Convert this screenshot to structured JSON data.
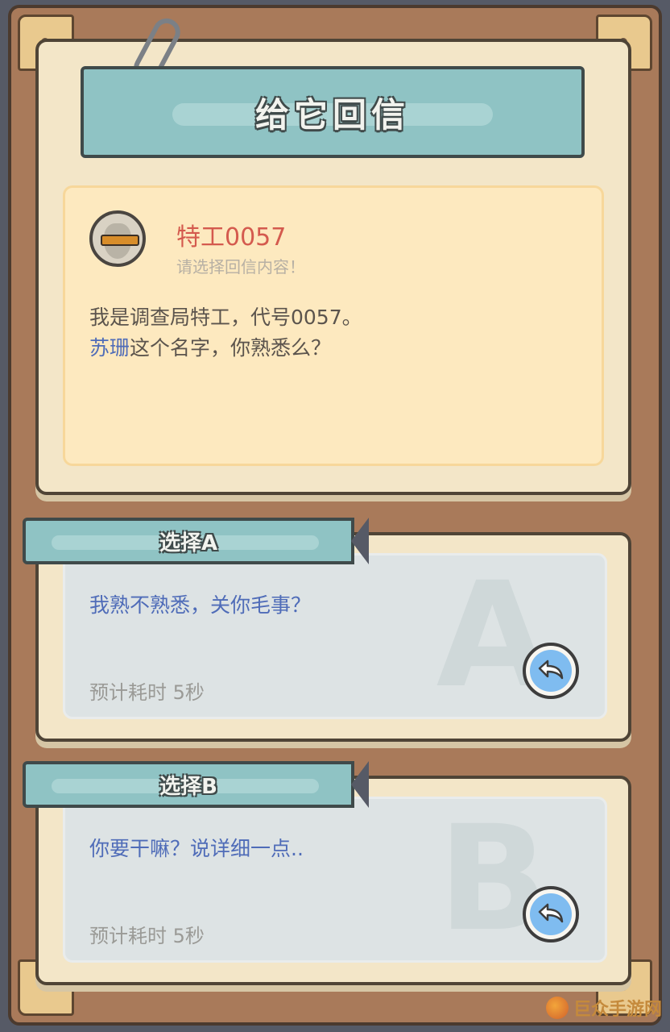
{
  "title": "给它回信",
  "letter": {
    "sender": "特工0057",
    "hint": "请选择回信内容！",
    "line1": "我是调查局特工，代号0057。",
    "line2_highlight": "苏珊",
    "line2_rest": "这个名字，你熟悉么？"
  },
  "options": [
    {
      "tab_label": "选择A",
      "big_letter": "A",
      "text": "我熟不熟悉，关你毛事？",
      "time": "预计耗时  5秒",
      "reply_icon": "reply-arrow-icon"
    },
    {
      "tab_label": "选择B",
      "big_letter": "B",
      "text": "你要干嘛？说详细一点..",
      "time": "预计耗时  5秒",
      "reply_icon": "reply-arrow-icon"
    }
  ],
  "watermark": {
    "text": "巨众手游网"
  },
  "colors": {
    "banner": "#8fc3c4",
    "panel": "#f3e6c8",
    "letter_bg": "#fde9bf",
    "sender_name": "#d45a4e",
    "option_text": "#4f6cb8",
    "reply_button": "#7fbcf0"
  }
}
